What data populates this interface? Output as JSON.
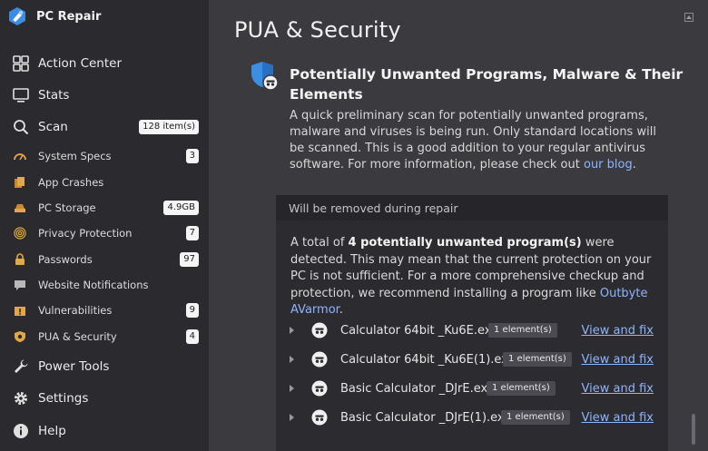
{
  "app": {
    "title": "PC Repair"
  },
  "sidebar": {
    "items": [
      {
        "label": "Action Center",
        "icon": "grid-icon",
        "badge": null
      },
      {
        "label": "Stats",
        "icon": "monitor-icon",
        "badge": null
      },
      {
        "label": "Scan",
        "icon": "search-icon",
        "badge": "128 item(s)"
      },
      {
        "label": "System Specs",
        "icon": "gauge-icon",
        "badge": "3"
      },
      {
        "label": "App Crashes",
        "icon": "files-icon",
        "badge": null
      },
      {
        "label": "PC Storage",
        "icon": "drive-icon",
        "badge": "4.9GB"
      },
      {
        "label": "Privacy Protection",
        "icon": "fingerprint-icon",
        "badge": "7"
      },
      {
        "label": "Passwords",
        "icon": "lock-icon",
        "badge": "97"
      },
      {
        "label": "Website Notifications",
        "icon": "chat-icon",
        "badge": null
      },
      {
        "label": "Vulnerabilities",
        "icon": "warning-folder-icon",
        "badge": "9"
      },
      {
        "label": "PUA & Security",
        "icon": "shield-icon",
        "badge": "4"
      },
      {
        "label": "Power Tools",
        "icon": "wrench-icon",
        "badge": null
      },
      {
        "label": "Settings",
        "icon": "gear-icon",
        "badge": null
      },
      {
        "label": "Help",
        "icon": "info-icon",
        "badge": null
      }
    ]
  },
  "main": {
    "title": "PUA & Security",
    "section": {
      "title": "Potentially Unwanted Programs, Malware & Their Elements",
      "desc_before_link": "A quick preliminary scan for potentially unwanted programs, malware and viruses is being run. Only standard locations will be scanned. This is a good addition to your regular antivirus software. For more information, please check out ",
      "desc_link": "our blog",
      "desc_after_link": "."
    },
    "panel": {
      "header": "Will be removed during repair",
      "text_prefix": "A total of ",
      "text_bold": "4 potentially unwanted program(s)",
      "text_middle": " were detected. This may mean that the current protection on your PC is not sufficient. For a more comprehensive checkup and protection, we recommend installing a program like ",
      "text_link": "Outbyte AVarmor",
      "text_suffix": ".",
      "rows": [
        {
          "name": "Calculator 64bit _Ku6E.exe",
          "badge": "1 element(s)",
          "action": "View and fix"
        },
        {
          "name": "Calculator 64bit _Ku6E(1).exe",
          "badge": "1 element(s)",
          "action": "View and fix"
        },
        {
          "name": "Basic Calculator _DJrE.exe",
          "badge": "1 element(s)",
          "action": "View and fix"
        },
        {
          "name": "Basic Calculator _DJrE(1).exe",
          "badge": "1 element(s)",
          "action": "View and fix"
        }
      ]
    }
  },
  "colors": {
    "accent_link": "#8fb3ff",
    "sidebar_bg": "#2b2b2f",
    "main_bg": "#3b3b3f",
    "panel_bg": "#2c2c30"
  }
}
